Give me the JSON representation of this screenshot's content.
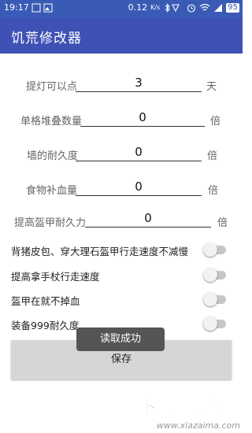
{
  "status_bar": {
    "time": "19:17",
    "network_speed": "0.12",
    "network_unit": "K/s",
    "battery": "95"
  },
  "app": {
    "title": "饥荒修改器"
  },
  "fields": [
    {
      "label": "提灯可以点",
      "value": "3",
      "unit": "天"
    },
    {
      "label": "单格堆叠数量",
      "value": "0",
      "unit": "倍"
    },
    {
      "label": "墙的耐久度",
      "value": "0",
      "unit": "倍"
    },
    {
      "label": "食物补血量",
      "value": "0",
      "unit": "倍"
    },
    {
      "label": "提高盔甲耐久力",
      "value": "0",
      "unit": "倍"
    }
  ],
  "toggles": [
    {
      "label": "背猪皮包、穿大理石盔甲行走速度不减慢",
      "on": false
    },
    {
      "label": "提高拿手杖行走速度",
      "on": false
    },
    {
      "label": "盔甲在就不掉血",
      "on": false
    },
    {
      "label": "装备999耐久度",
      "on": false
    }
  ],
  "save_label": "保存",
  "toast": "读取成功",
  "watermark": {
    "title": "下载马应用",
    "url": "www.xiazaima.com"
  },
  "colors": {
    "status_bar": "#3a5bb5",
    "app_bar": "#3f51b5",
    "button": "#d6d6d6",
    "toast": "#555555"
  }
}
